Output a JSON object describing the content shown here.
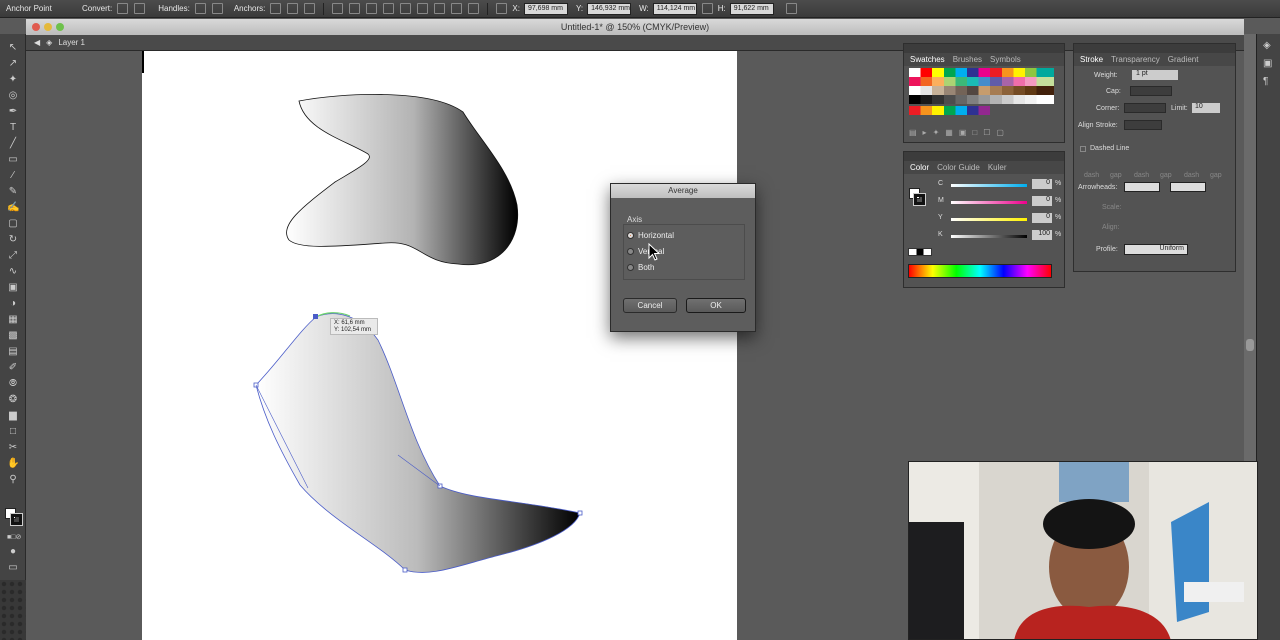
{
  "control_bar": {
    "tool_name": "Anchor Point",
    "convert_label": "Convert:",
    "handles_label": "Handles:",
    "anchors_label": "Anchors:",
    "x_label": "X:",
    "x_value": "97,698 mm",
    "y_label": "Y:",
    "y_value": "146,932 mm",
    "w_label": "W:",
    "w_value": "114,124 mm",
    "h_label": "H:",
    "h_value": "91,622 mm"
  },
  "document": {
    "title": "Untitled-1* @ 150% (CMYK/Preview)",
    "layer_name": "Layer 1"
  },
  "tooltip": {
    "x_readout": "X: 61,6 mm",
    "y_readout": "Y: 102,54 mm"
  },
  "swatches_panel": {
    "tabs": [
      "Swatches",
      "Brushes",
      "Symbols"
    ]
  },
  "color_panel": {
    "tabs": [
      "Color",
      "Color Guide",
      "Kuler"
    ],
    "channels": [
      {
        "label": "C",
        "value": "0",
        "unit": "%"
      },
      {
        "label": "M",
        "value": "0",
        "unit": "%"
      },
      {
        "label": "Y",
        "value": "0",
        "unit": "%"
      },
      {
        "label": "K",
        "value": "100",
        "unit": "%"
      }
    ]
  },
  "stroke_panel": {
    "tabs": [
      "Stroke",
      "Transparency",
      "Gradient"
    ],
    "weight_label": "Weight:",
    "weight_value": "1 pt",
    "cap_label": "Cap:",
    "corner_label": "Corner:",
    "limit_label": "Limit:",
    "limit_value": "10",
    "align_label": "Align Stroke:",
    "dashed_label": "Dashed Line",
    "dash_labels": [
      "dash",
      "gap",
      "dash",
      "gap",
      "dash",
      "gap"
    ],
    "arrowheads_label": "Arrowheads:",
    "scale_label": "Scale:",
    "align2_label": "Align:",
    "profile_label": "Profile:",
    "profile_value": "Uniform"
  },
  "dialog": {
    "title": "Average",
    "axis_label": "Axis",
    "options": [
      "Horizontal",
      "Vertical",
      "Both"
    ],
    "selected": "Horizontal",
    "cancel_label": "Cancel",
    "ok_label": "OK"
  },
  "colors": {
    "accent": "#e0651f",
    "selection": "#4a5cc8"
  }
}
